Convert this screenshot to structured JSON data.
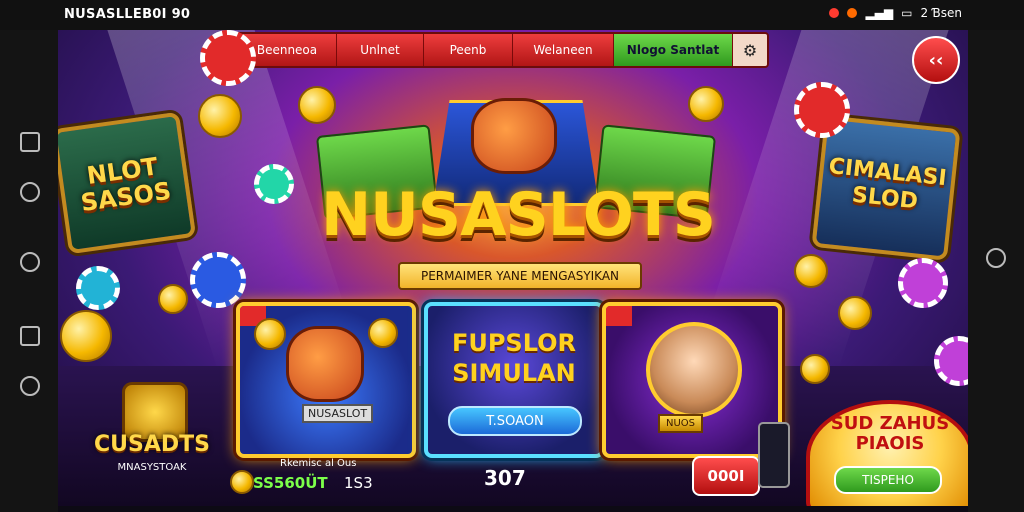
{
  "status_bar": {
    "app_title": "NUSASLLEB0I 90",
    "right_text": "2 Ɓsen"
  },
  "nav": {
    "tabs": [
      {
        "label": "Beenneoa"
      },
      {
        "label": "Unlnet"
      },
      {
        "label": "Peenb"
      },
      {
        "label": "Welaneen"
      },
      {
        "label": "Nlogo Santlat"
      }
    ],
    "tab_icon": "slot-machine-icon",
    "back_label": "‹‹"
  },
  "hero": {
    "title": "NUSASLOTS",
    "subtitle": "PERMAIMER YANE MENGASYIKAN"
  },
  "side_panels": {
    "left": "NLOT SASOS",
    "right": "CIMALASI SLOD"
  },
  "cards": {
    "card1": {
      "label": "NUSASLOT"
    },
    "card2": {
      "title_line1": "FUPSLOR",
      "title_line2": "SIMULAN",
      "button": "T.SOAON"
    },
    "card3": {
      "tag": "NUOS"
    }
  },
  "bottom": {
    "left_badge": "CUSADTS",
    "left_badge_sub": "MNASYSTOAK",
    "stat_label": "Rkemisc al Ous",
    "balance": "SS560ÜT",
    "balance2": "1S3",
    "center_value": "307",
    "red_button": "000I"
  },
  "promo": {
    "title_line1": "SUD ZAHUS",
    "title_line2": "PIAOIS",
    "button": "TISPEHO"
  },
  "colors": {
    "accent_red": "#e22a2a",
    "accent_gold": "#ffd21f",
    "accent_green": "#3fb62a",
    "accent_blue": "#1c6ad8",
    "bg_purple": "#3b1a75"
  }
}
